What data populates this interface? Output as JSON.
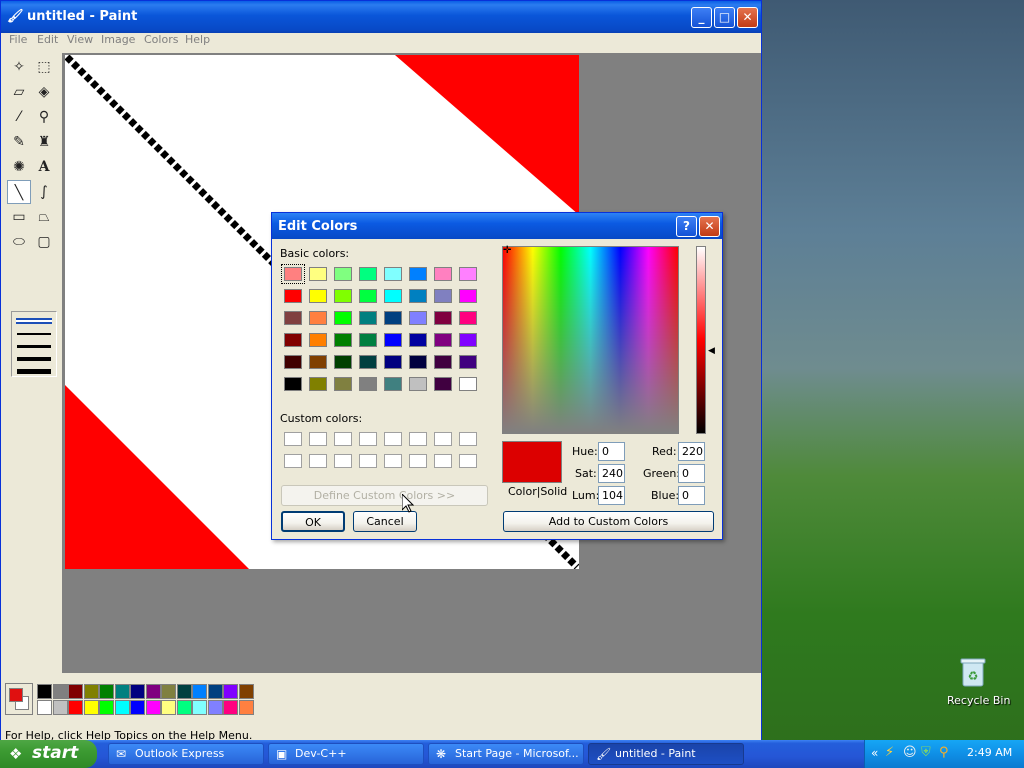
{
  "paint_window": {
    "title": "untitled - Paint",
    "menu": [
      "File",
      "Edit",
      "View",
      "Image",
      "Colors",
      "Help"
    ],
    "status_text": "For Help, click Help Topics on the Help Menu.",
    "palette_colors": [
      "#000000",
      "#808080",
      "#800000",
      "#808000",
      "#008000",
      "#008080",
      "#000080",
      "#800080",
      "#808040",
      "#004040",
      "#0080ff",
      "#004080",
      "#8000ff",
      "#804000",
      "#ffffff",
      "#c0c0c0",
      "#ff0000",
      "#ffff00",
      "#00ff00",
      "#00ffff",
      "#0000ff",
      "#ff00ff",
      "#ffff80",
      "#00ff80",
      "#80ffff",
      "#8080ff",
      "#ff0080",
      "#ff8040"
    ],
    "primary_color": "#e01010",
    "secondary_color": "#ffffff"
  },
  "dialog": {
    "title": "Edit Colors",
    "basic_colors_label": "Basic colors:",
    "custom_colors_label": "Custom colors:",
    "define_button": "Define Custom Colors >>",
    "ok_button": "OK",
    "cancel_button": "Cancel",
    "add_button": "Add to Custom Colors",
    "color_solid_label": "Color|Solid",
    "current_color": "#dc0000",
    "hue_label": "Hue:",
    "hue": "0",
    "sat_label": "Sat:",
    "sat": "240",
    "lum_label": "Lum:",
    "lum": "104",
    "red_label": "Red:",
    "red": "220",
    "green_label": "Green:",
    "green": "0",
    "blue_label": "Blue:",
    "blue": "0",
    "basic_colors": [
      "#ff8080",
      "#ffff80",
      "#80ff80",
      "#00ff80",
      "#80ffff",
      "#0080ff",
      "#ff80c0",
      "#ff80ff",
      "#ff0000",
      "#ffff00",
      "#80ff00",
      "#00ff40",
      "#00ffff",
      "#0080c0",
      "#8080c0",
      "#ff00ff",
      "#804040",
      "#ff8040",
      "#00ff00",
      "#008080",
      "#004080",
      "#8080ff",
      "#800040",
      "#ff0080",
      "#800000",
      "#ff8000",
      "#008000",
      "#008040",
      "#0000ff",
      "#0000a0",
      "#800080",
      "#8000ff",
      "#400000",
      "#804000",
      "#004000",
      "#004040",
      "#000080",
      "#000040",
      "#400040",
      "#400080",
      "#000000",
      "#808000",
      "#808040",
      "#808080",
      "#408080",
      "#c0c0c0",
      "#400040",
      "#ffffff"
    ]
  },
  "desktop": {
    "recycle_bin_label": "Recycle Bin"
  },
  "taskbar": {
    "start_label": "start",
    "tasks": [
      "Outlook Express",
      "Dev-C++",
      "Start Page - Microsof...",
      "untitled - Paint"
    ],
    "clock": "2:49 AM"
  }
}
